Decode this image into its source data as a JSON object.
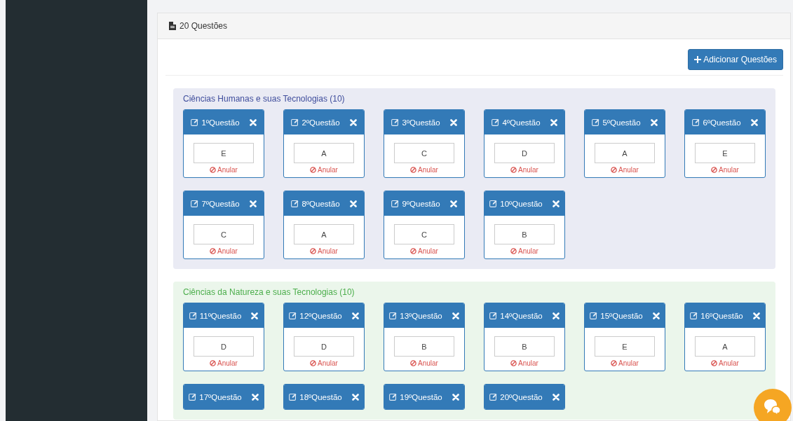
{
  "panel": {
    "title": "20 Questões",
    "add_button": "Adicionar Questões"
  },
  "sections": [
    {
      "title": "Ciências Humanas e suas Tecnologias (10)",
      "color": "#3f4d9c",
      "questions": [
        {
          "label": "1ºQuestão",
          "answer": "E",
          "cancel": "Anular"
        },
        {
          "label": "2ºQuestão",
          "answer": "A",
          "cancel": "Anular"
        },
        {
          "label": "3ºQuestão",
          "answer": "C",
          "cancel": "Anular"
        },
        {
          "label": "4ºQuestão",
          "answer": "D",
          "cancel": "Anular"
        },
        {
          "label": "5ºQuestão",
          "answer": "A",
          "cancel": "Anular"
        },
        {
          "label": "6ºQuestão",
          "answer": "E",
          "cancel": "Anular"
        },
        {
          "label": "7ºQuestão",
          "answer": "C",
          "cancel": "Anular"
        },
        {
          "label": "8ºQuestão",
          "answer": "A",
          "cancel": "Anular"
        },
        {
          "label": "9ºQuestão",
          "answer": "C",
          "cancel": "Anular"
        },
        {
          "label": "10ºQuestão",
          "answer": "B",
          "cancel": "Anular"
        }
      ]
    },
    {
      "title": "Ciências da Natureza e suas Tecnologias (10)",
      "color": "#4cae4c",
      "questions": [
        {
          "label": "11ºQuestão",
          "answer": "D",
          "cancel": "Anular"
        },
        {
          "label": "12ºQuestão",
          "answer": "D",
          "cancel": "Anular"
        },
        {
          "label": "13ºQuestão",
          "answer": "B",
          "cancel": "Anular"
        },
        {
          "label": "14ºQuestão",
          "answer": "B",
          "cancel": "Anular"
        },
        {
          "label": "15ºQuestão",
          "answer": "E",
          "cancel": "Anular"
        },
        {
          "label": "16ºQuestão",
          "answer": "A",
          "cancel": "Anular"
        },
        {
          "label": "17ºQuestão"
        },
        {
          "label": "18ºQuestão"
        },
        {
          "label": "19ºQuestão"
        },
        {
          "label": "20ºQuestão"
        }
      ]
    }
  ]
}
